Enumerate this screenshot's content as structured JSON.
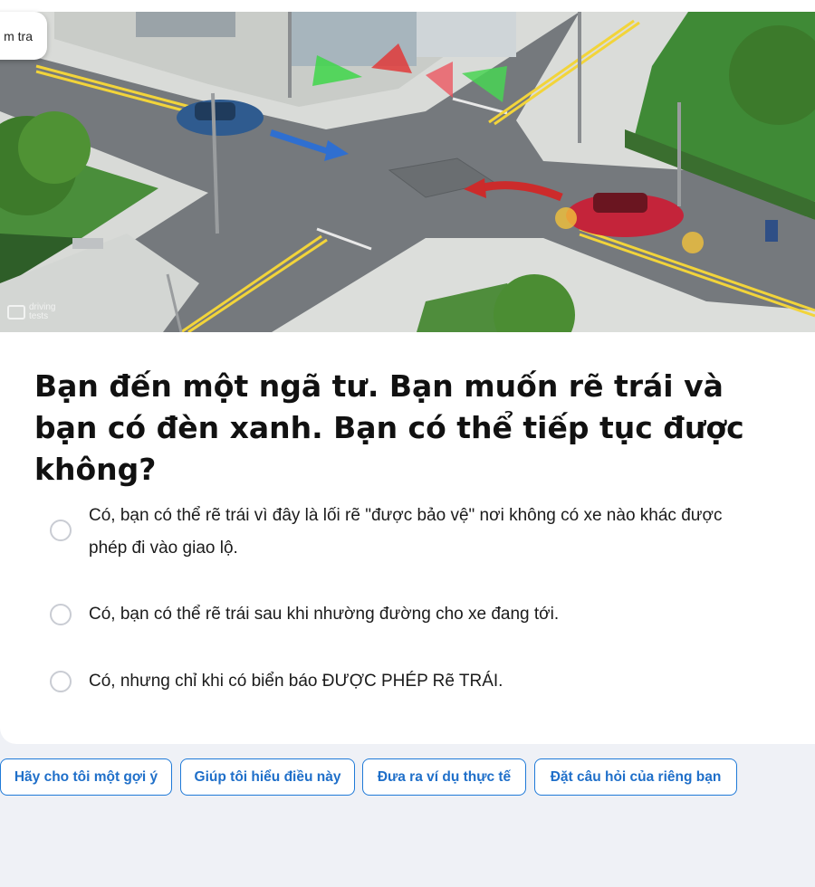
{
  "image_tag": {
    "label": "m tra"
  },
  "watermark": {
    "line1": "driving",
    "line2": "tests"
  },
  "question": "Bạn đến một ngã tư. Bạn muốn rẽ trái và bạn có đèn xanh. Bạn có thể tiếp tục được không?",
  "answers": [
    {
      "text": "Có, bạn có thể rẽ trái vì đây là lối rẽ \"được bảo vệ\" nơi không có xe nào khác được phép đi vào giao lộ.",
      "selected": false
    },
    {
      "text": "Có, bạn có thể rẽ trái sau khi nhường đường cho xe đang tới.",
      "selected": false
    },
    {
      "text": "Có, nhưng chỉ khi có biển báo ĐƯỢC PHÉP Rẽ TRÁI.",
      "selected": false
    }
  ],
  "chips": [
    {
      "label": "Hãy cho tôi một gợi ý"
    },
    {
      "label": "Giúp tôi hiểu điều này"
    },
    {
      "label": "Đưa ra ví dụ thực tế"
    },
    {
      "label": "Đặt câu hỏi của riêng bạn"
    }
  ],
  "colors": {
    "accent": "#1f7ad8",
    "background": "#eff1f6",
    "card": "#ffffff"
  }
}
